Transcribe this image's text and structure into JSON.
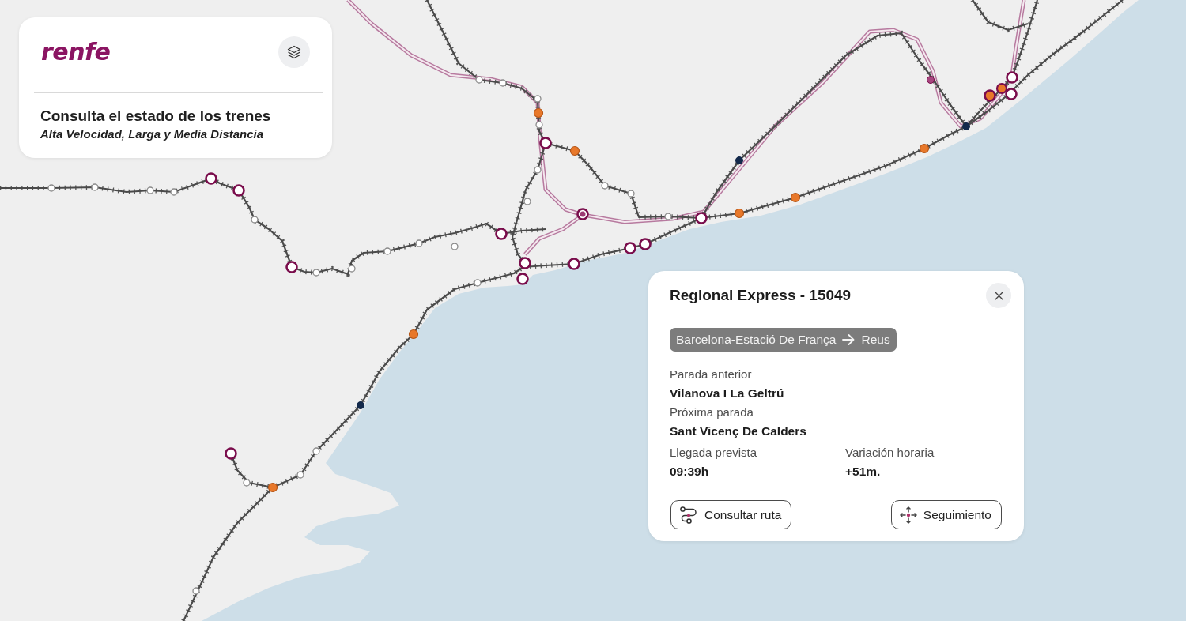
{
  "header": {
    "logo": "renfe",
    "title": "Consulta el estado de los trenes",
    "subtitle": "Alta Velocidad, Larga y Media Distancia"
  },
  "train_card": {
    "title": "Regional Express - 15049",
    "route": {
      "origin": "Barcelona-Estació De França",
      "destination": "Reus"
    },
    "details": [
      {
        "label": "Parada anterior",
        "value": "Vilanova I La Geltrú"
      },
      {
        "label": "Próxima parada",
        "value": "Sant Vicenç De Calders"
      },
      {
        "label": "Llegada prevista",
        "value": "09:39h"
      },
      {
        "label": "Variación horaria",
        "value": "+51m."
      }
    ],
    "buttons": [
      {
        "kind": "route",
        "label": "Consultar ruta"
      },
      {
        "kind": "follow",
        "label": "Seguimiento"
      }
    ]
  }
}
